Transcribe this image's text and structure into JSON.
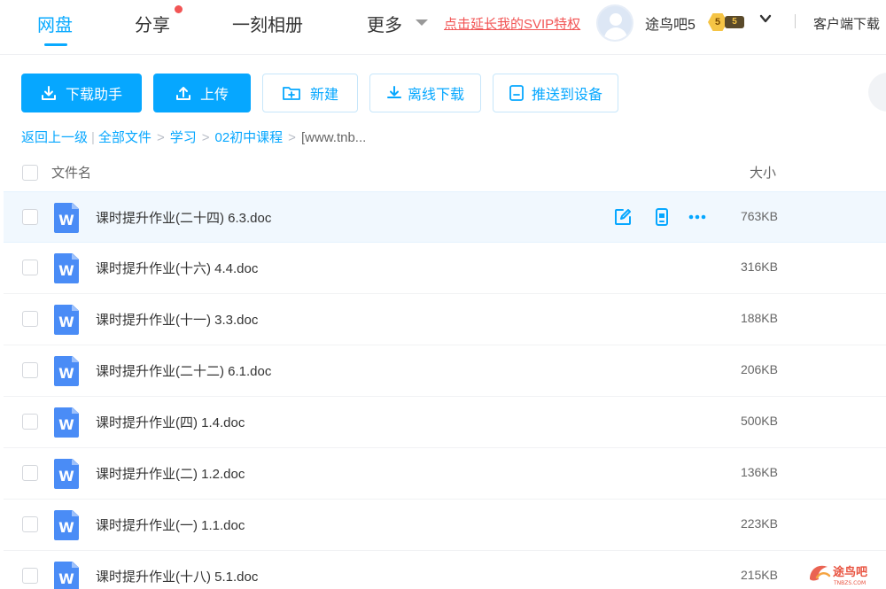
{
  "nav": {
    "items": [
      "网盘",
      "分享",
      "一刻相册",
      "更多"
    ],
    "svip_link": "点击延长我的SVIP特权",
    "username": "途鸟吧5",
    "vip_level": "5",
    "vip_level2": "5",
    "client_download": "客户端下载"
  },
  "toolbar": {
    "download_helper": "下载助手",
    "upload": "上传",
    "new": "新建",
    "offline_download": "离线下载",
    "push_device": "推送到设备"
  },
  "breadcrumb": {
    "back": "返回上一级",
    "separator_bar": "|",
    "sep": ">",
    "items": [
      "全部文件",
      "学习",
      "02初中课程"
    ],
    "current": "[www.tnb..."
  },
  "list": {
    "header_name": "文件名",
    "header_size": "大小",
    "icon_letter": "W",
    "rows": [
      {
        "name": "课时提升作业(二十四) 6.3.doc",
        "size": "763KB"
      },
      {
        "name": "课时提升作业(十六) 4.4.doc",
        "size": "316KB"
      },
      {
        "name": "课时提升作业(十一) 3.3.doc",
        "size": "188KB"
      },
      {
        "name": "课时提升作业(二十二) 6.1.doc",
        "size": "206KB"
      },
      {
        "name": "课时提升作业(四) 1.4.doc",
        "size": "500KB"
      },
      {
        "name": "课时提升作业(二) 1.2.doc",
        "size": "136KB"
      },
      {
        "name": "课时提升作业(一) 1.1.doc",
        "size": "223KB"
      },
      {
        "name": "课时提升作业(十八) 5.1.doc",
        "size": "215KB"
      }
    ]
  },
  "watermark": {
    "text": "途鸟吧",
    "sub": "TNBZS.COM"
  },
  "colors": {
    "accent": "#06a7ff",
    "red": "#f25555",
    "doc_blue": "#4a8cf6"
  }
}
